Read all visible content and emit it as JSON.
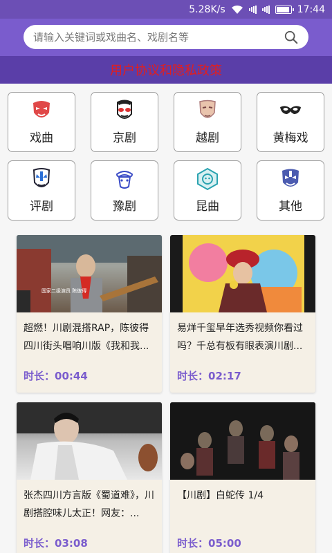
{
  "status": {
    "speed": "5.28K/s",
    "time": "17:44"
  },
  "search": {
    "placeholder": "请输入关键词或戏曲名、戏剧名等"
  },
  "policy": {
    "label": "用户协议和隐私政策"
  },
  "categories": [
    {
      "label": "戏曲",
      "icon": "red-opera-mask-icon"
    },
    {
      "label": "京剧",
      "icon": "peking-opera-face-icon"
    },
    {
      "label": "越剧",
      "icon": "beige-mask-icon"
    },
    {
      "label": "黄梅戏",
      "icon": "eye-mask-icon"
    },
    {
      "label": "评剧",
      "icon": "blue-face-mask-icon"
    },
    {
      "label": "豫剧",
      "icon": "opera-headdress-icon"
    },
    {
      "label": "昆曲",
      "icon": "hexagon-mask-icon"
    },
    {
      "label": "其他",
      "icon": "blue-painted-face-icon"
    }
  ],
  "videos": [
    {
      "title": "超燃！川剧混搭RAP，陈彼得四川街头唱响川版《我和我...",
      "duration_label": "时长：",
      "duration": "00:44",
      "thumb_caption": "国家二级演员 陈彼得"
    },
    {
      "title": "易烊千玺早年选秀视频你看过吗？千总有板有眼表演川剧...",
      "duration_label": "时长：",
      "duration": "02:17",
      "thumb_caption": ""
    },
    {
      "title": "张杰四川方言版《蜀道难》，川剧搭腔味儿太正！网友：...",
      "duration_label": "时长：",
      "duration": "03:08",
      "thumb_caption": ""
    },
    {
      "title": "【川剧】白蛇传 1/4",
      "duration_label": "时长：",
      "duration": "05:00",
      "thumb_caption": ""
    }
  ]
}
